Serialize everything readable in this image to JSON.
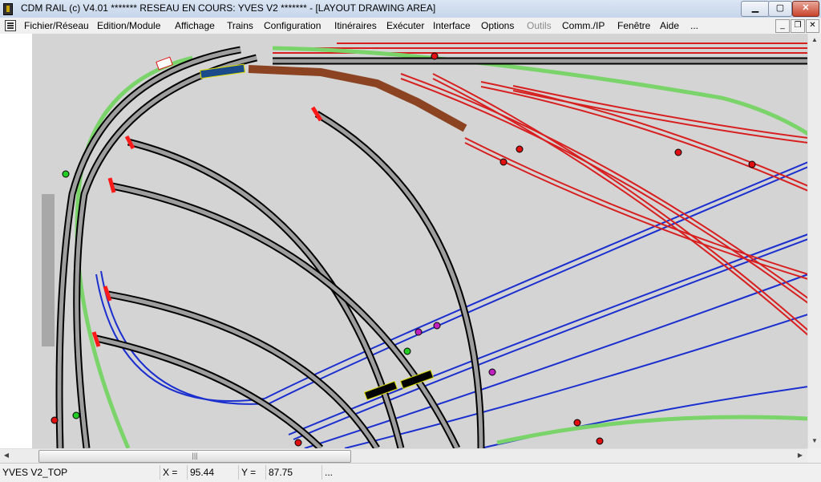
{
  "window": {
    "title": "CDM RAIL (c) V4.01     ******* RESEAU EN COURS: YVES V2 ******* - [LAYOUT DRAWING AREA]",
    "buttons": {
      "minimize": "▁",
      "maximize": "▢",
      "close": "✕"
    }
  },
  "menu": {
    "items": [
      {
        "label": "Fichier/Réseau",
        "enabled": true
      },
      {
        "label": "Edition/Module",
        "enabled": true
      },
      {
        "label": "Affichage",
        "enabled": true
      },
      {
        "label": "Trains",
        "enabled": true
      },
      {
        "label": "Configuration",
        "enabled": true
      },
      {
        "label": "Itinéraires",
        "enabled": true
      },
      {
        "label": "Exécuter",
        "enabled": true
      },
      {
        "label": "Interface",
        "enabled": true
      },
      {
        "label": "Options",
        "enabled": true
      },
      {
        "label": "Outils",
        "enabled": false
      },
      {
        "label": "Comm./IP",
        "enabled": true
      },
      {
        "label": "Fenêtre",
        "enabled": true
      },
      {
        "label": "Aide",
        "enabled": true
      },
      {
        "label": "...",
        "enabled": true
      }
    ],
    "mdi_buttons": {
      "minimize": "_",
      "restore": "❐",
      "close": "✕"
    }
  },
  "scrollbars": {
    "up": "▲",
    "down": "▼",
    "left": "◀",
    "right": "▶",
    "grip": "|||"
  },
  "status": {
    "layout_name": "YVES V2_TOP",
    "x_label": "X =",
    "x_value": "95.44",
    "y_label": "Y =",
    "y_value": "87.75",
    "extra": "..."
  },
  "colors": {
    "canvas_bg": "#d4d4d4",
    "track_black": "#000000",
    "track_red": "#d81f1f",
    "track_blue": "#1b2fcf",
    "track_green": "#7ad46a",
    "track_brown": "#8b4322",
    "bumper": "#ff1a1a"
  }
}
